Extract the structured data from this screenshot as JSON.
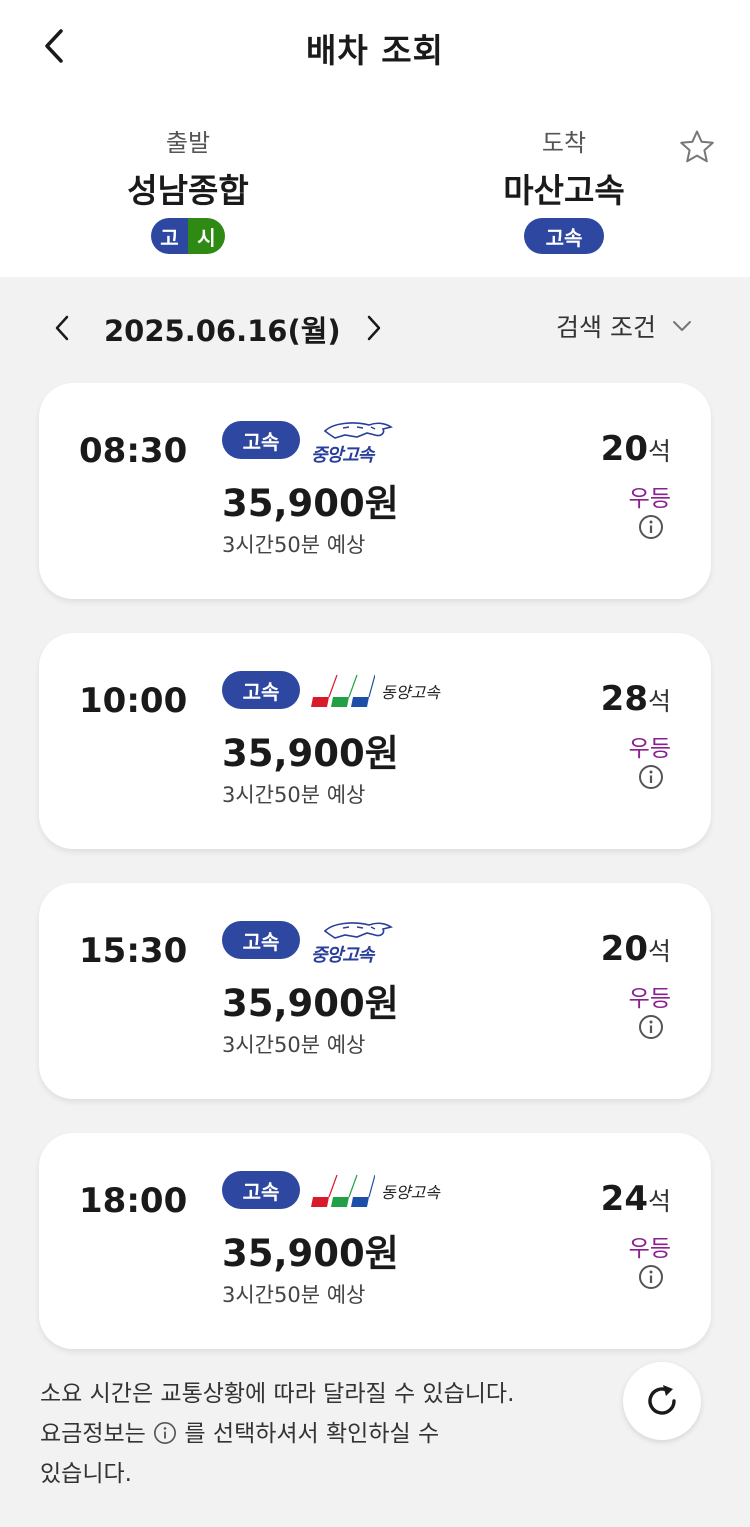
{
  "header": {
    "title": "배차 조회",
    "back_icon": "chevron-left-icon",
    "favorite_icon": "star-outline-icon"
  },
  "route": {
    "departure": {
      "label": "출발",
      "name": "성남종합",
      "badges": [
        "고",
        "시"
      ]
    },
    "arrival": {
      "label": "도착",
      "name": "마산고속",
      "badge": "고속"
    }
  },
  "date_bar": {
    "date": "2025.06.16(월)",
    "filter_label": "검색 조건"
  },
  "colors": {
    "badge_blue": "#2e47a0",
    "badge_green": "#2e8a12",
    "class_purple": "#8a1f8f",
    "background": "#f2f2f2"
  },
  "schedules": [
    {
      "time": "08:30",
      "grade": "고속",
      "company": "중앙고속",
      "company_logo": "jungang-express-logo",
      "price": "35,900원",
      "duration": "3시간50분 예상",
      "seats": "20",
      "seat_unit": "석",
      "class": "우등"
    },
    {
      "time": "10:00",
      "grade": "고속",
      "company": "동양고속",
      "company_logo": "dongyang-express-logo",
      "price": "35,900원",
      "duration": "3시간50분 예상",
      "seats": "28",
      "seat_unit": "석",
      "class": "우등"
    },
    {
      "time": "15:30",
      "grade": "고속",
      "company": "중앙고속",
      "company_logo": "jungang-express-logo",
      "price": "35,900원",
      "duration": "3시간50분 예상",
      "seats": "20",
      "seat_unit": "석",
      "class": "우등"
    },
    {
      "time": "18:00",
      "grade": "고속",
      "company": "동양고속",
      "company_logo": "dongyang-express-logo",
      "price": "35,900원",
      "duration": "3시간50분 예상",
      "seats": "24",
      "seat_unit": "석",
      "class": "우등"
    }
  ],
  "notice": {
    "line1": "소요 시간은 교통상황에 따라 달라질 수 있습니다.",
    "line2_before": "요금정보는 ",
    "line2_after": " 를 선택하셔서 확인하실 수",
    "line3": "있습니다."
  }
}
